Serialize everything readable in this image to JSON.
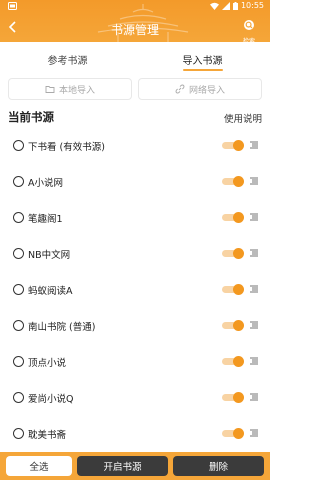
{
  "status_bar": {
    "time": "10:55"
  },
  "header": {
    "title": "书源管理",
    "search_label": "检索"
  },
  "tabs": [
    {
      "label": "参考书源",
      "active": false
    },
    {
      "label": "导入书源",
      "active": true
    }
  ],
  "import_buttons": {
    "local": "本地导入",
    "network": "网络导入"
  },
  "section": {
    "title": "当前书源",
    "help": "使用说明"
  },
  "sources": [
    {
      "name": "下书看 (有效书源)",
      "enabled": true
    },
    {
      "name": "A小说网",
      "enabled": true
    },
    {
      "name": "笔趣阁1",
      "enabled": true
    },
    {
      "name": "NB中文网",
      "enabled": true
    },
    {
      "name": "蚂蚁阅读A",
      "enabled": true
    },
    {
      "name": "南山书院 (普通)",
      "enabled": true
    },
    {
      "name": "顶点小说",
      "enabled": true
    },
    {
      "name": "爱尚小说Q",
      "enabled": true
    },
    {
      "name": "耽美书斋",
      "enabled": true
    }
  ],
  "bottom_bar": {
    "select_all": "全选",
    "enable_sources": "开启书源",
    "delete": "删除"
  },
  "colors": {
    "accent": "#f5a639",
    "toggle_on": "#f3981f",
    "dark_button": "#3b3b3b"
  }
}
